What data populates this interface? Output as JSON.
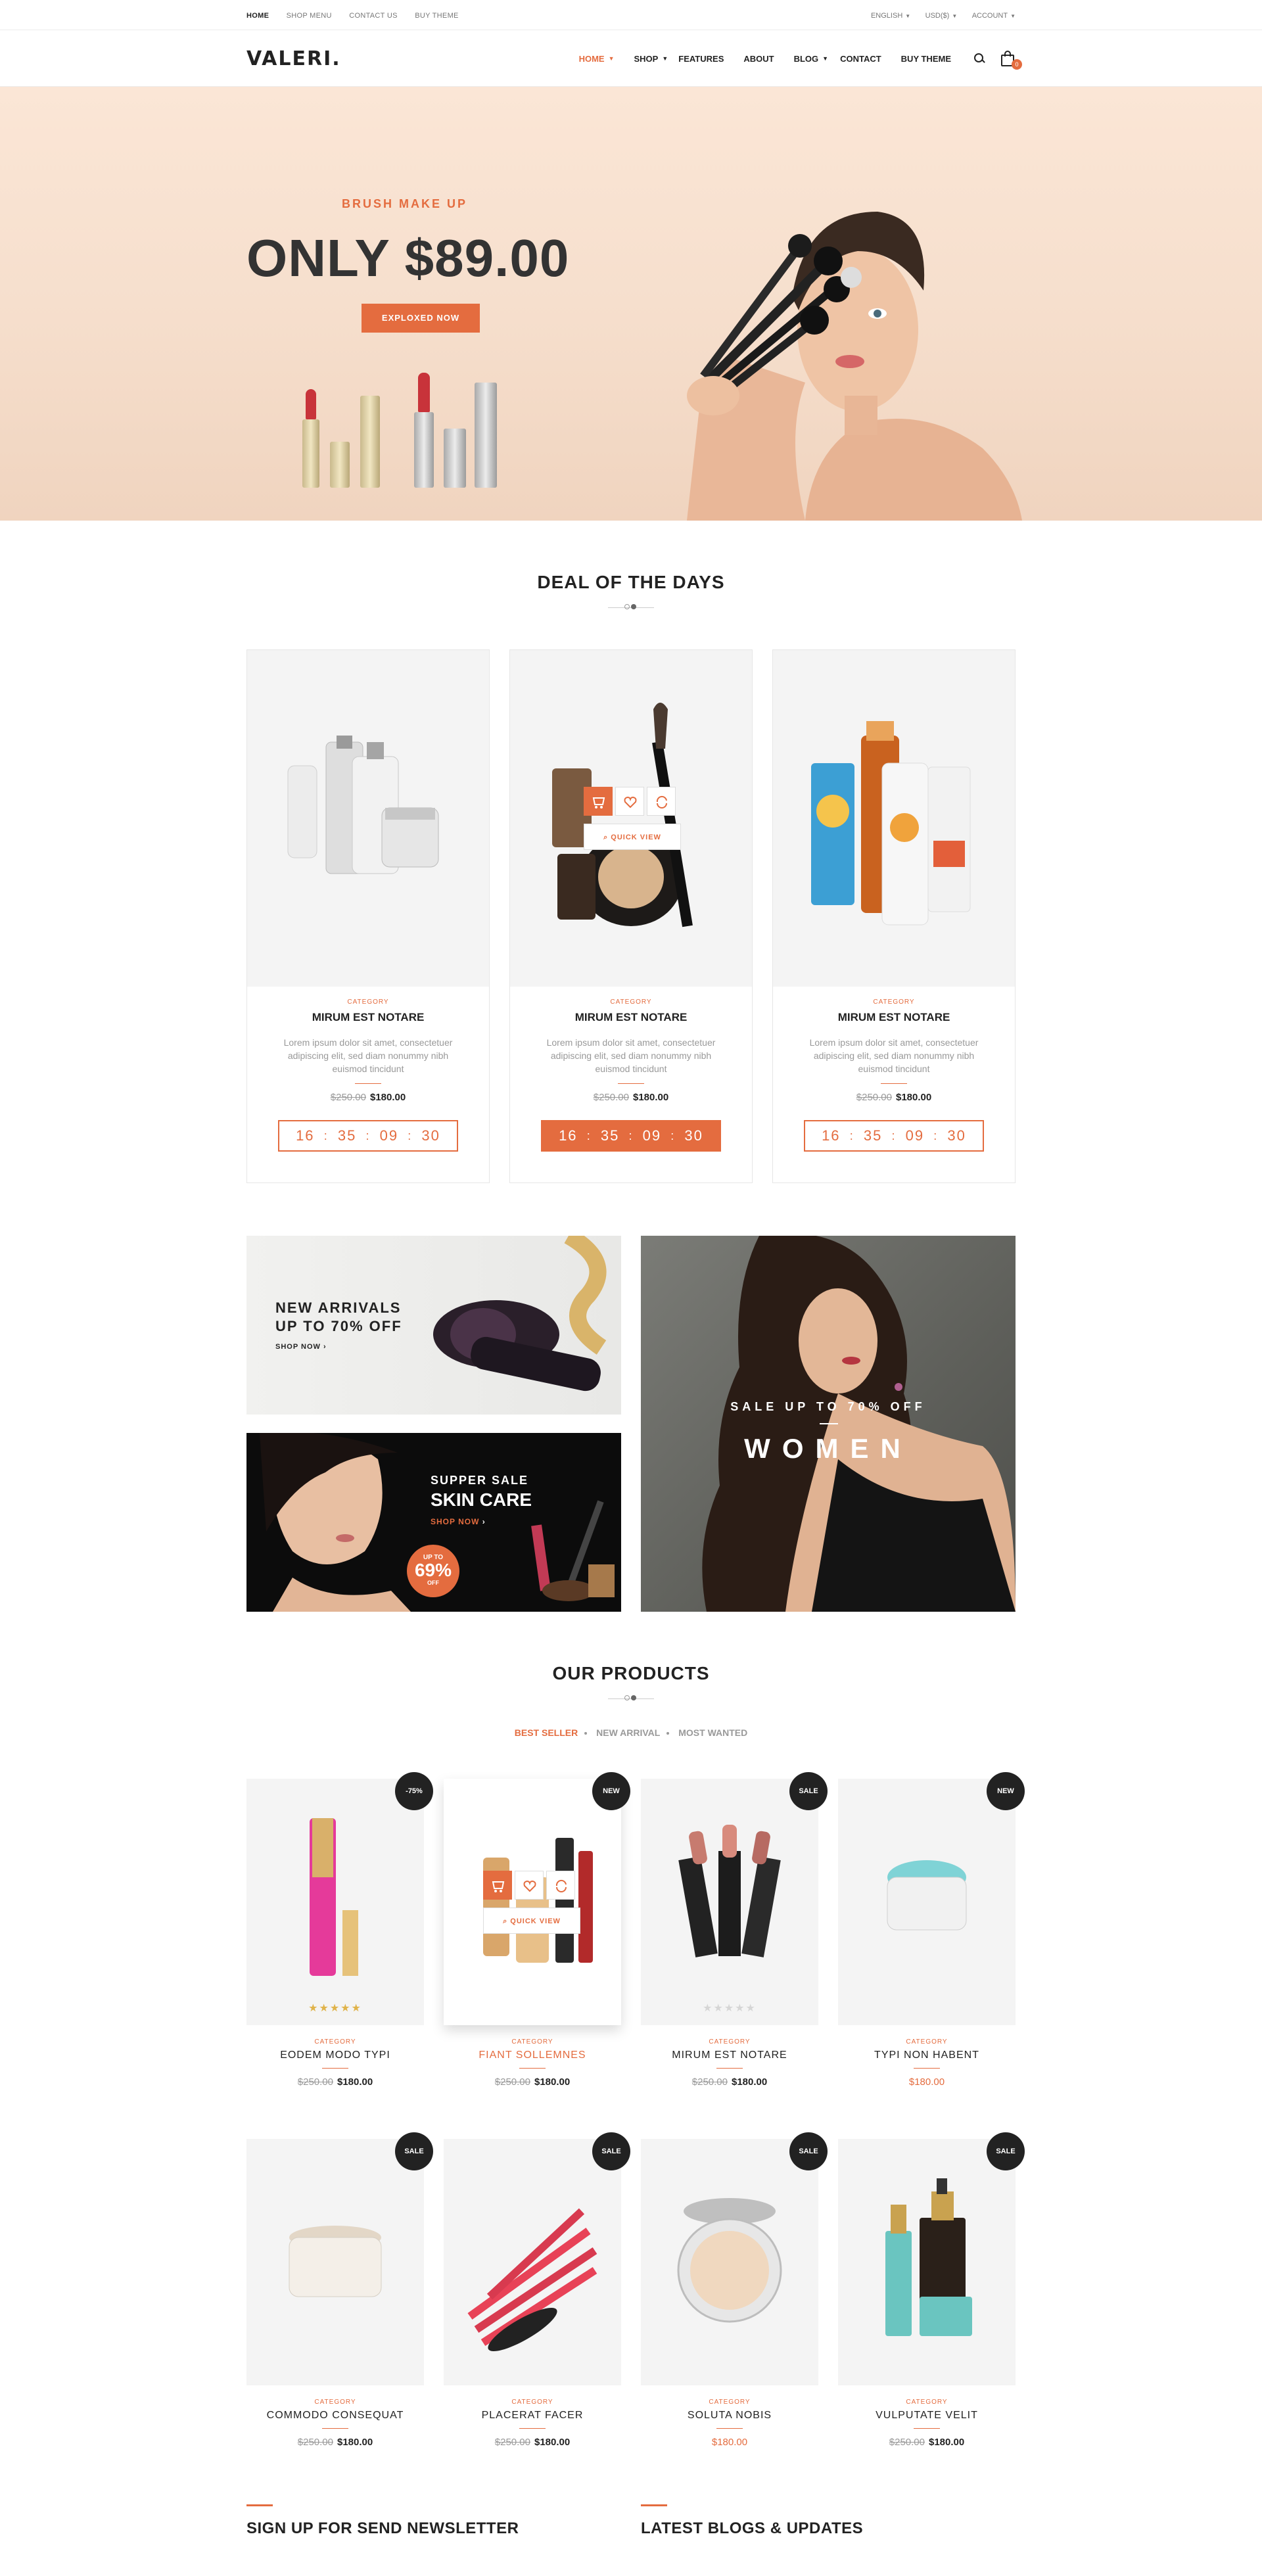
{
  "topbar": {
    "links": [
      "HOME",
      "SHOP MENU",
      "CONTACT US",
      "BUY THEME"
    ],
    "right": [
      "ENGLISH",
      "USD($)",
      "ACCOUNT"
    ]
  },
  "header": {
    "logo": "VALERI.",
    "nav": [
      "HOME",
      "SHOP",
      "FEATURES",
      "ABOUT",
      "BLOG",
      "CONTACT",
      "BUY THEME"
    ],
    "cart_count": "0"
  },
  "hero": {
    "subtitle": "BRUSH MAKE UP",
    "headline": "ONLY $89.00",
    "button": "EXPLOXED NOW"
  },
  "deals": {
    "title": "DEAL OF THE DAYS",
    "items": [
      {
        "category": "CATEGORY",
        "name": "MIRUM EST NOTARE",
        "desc": "Lorem ipsum dolor sit amet, consectetuer adipiscing elit, sed diam nonummy nibh euismod tincidunt",
        "old_price": "$250.00",
        "price": "$180.00",
        "timer": [
          "16",
          "35",
          "09",
          "30"
        ]
      },
      {
        "category": "CATEGORY",
        "name": "MIRUM EST NOTARE",
        "desc": "Lorem ipsum dolor sit amet, consectetuer adipiscing elit, sed diam nonummy nibh euismod tincidunt",
        "old_price": "$250.00",
        "price": "$180.00",
        "timer": [
          "16",
          "35",
          "09",
          "30"
        ]
      },
      {
        "category": "CATEGORY",
        "name": "MIRUM EST NOTARE",
        "desc": "Lorem ipsum dolor sit amet, consectetuer adipiscing elit, sed diam nonummy nibh euismod tincidunt",
        "old_price": "$250.00",
        "price": "$180.00",
        "timer": [
          "16",
          "35",
          "09",
          "30"
        ]
      }
    ],
    "quick_view": "QUICK VIEW"
  },
  "banners": {
    "a": {
      "line1": "NEW ARRIVALS",
      "line2": "UP TO 70% OFF",
      "shop": "SHOP NOW"
    },
    "b": {
      "line1": "SUPPER SALE",
      "line2": "SKIN CARE",
      "shop": "SHOP NOW",
      "badge_small": "UP TO",
      "badge_big": "69%",
      "badge_off": "OFF"
    },
    "c": {
      "line1": "SALE UP TO 70% OFF",
      "line2": "WOMEN"
    }
  },
  "products": {
    "title": "OUR PRODUCTS",
    "tabs": [
      "BEST SELLER",
      "NEW ARRIVAL",
      "MOST WANTED"
    ],
    "quick_view": "QUICK VIEW",
    "items": [
      {
        "tag": "-75%",
        "category": "CATEGORY",
        "name": "EODEM MODO TYPI",
        "old_price": "$250.00",
        "price": "$180.00"
      },
      {
        "tag": "NEW",
        "category": "CATEGORY",
        "name": "FIANT SOLLEMNES",
        "old_price": "$250.00",
        "price": "$180.00"
      },
      {
        "tag": "SALE",
        "category": "CATEGORY",
        "name": "MIRUM EST NOTARE",
        "old_price": "$250.00",
        "price": "$180.00"
      },
      {
        "tag": "NEW",
        "category": "CATEGORY",
        "name": "TYPI NON HABENT",
        "old_price": "",
        "price": "$180.00"
      },
      {
        "tag": "SALE",
        "category": "CATEGORY",
        "name": "COMMODO CONSEQUAT",
        "old_price": "$250.00",
        "price": "$180.00"
      },
      {
        "tag": "SALE",
        "category": "CATEGORY",
        "name": "PLACERAT FACER",
        "old_price": "$250.00",
        "price": "$180.00"
      },
      {
        "tag": "SALE",
        "category": "CATEGORY",
        "name": "SOLUTA NOBIS",
        "old_price": "",
        "price": "$180.00"
      },
      {
        "tag": "SALE",
        "category": "CATEGORY",
        "name": "VULPUTATE VELIT",
        "old_price": "$250.00",
        "price": "$180.00"
      }
    ]
  },
  "bottom": {
    "newsletter_title": "SIGN UP FOR SEND NEWSLETTER",
    "blogs_title": "LATEST BLOGS & UPDATES"
  },
  "colors": {
    "accent": "#e46c3f",
    "dark": "#222222",
    "tag_bg": "#222222"
  }
}
